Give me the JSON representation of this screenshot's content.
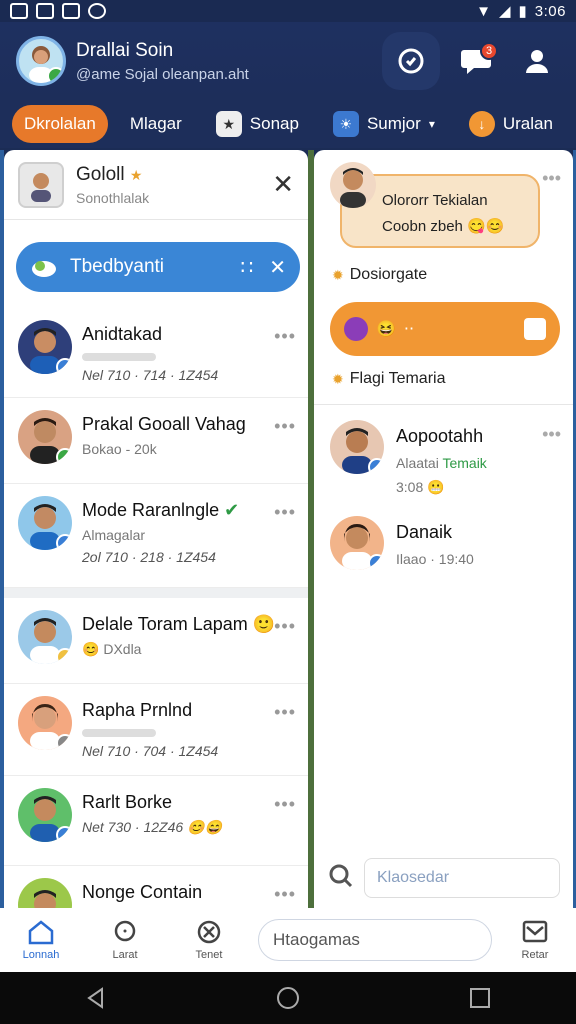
{
  "status_bar": {
    "time": "3:06"
  },
  "header": {
    "name": "Drallai Soin",
    "subtitle": "@ame Sojal oleanpan.aht"
  },
  "tabs": [
    {
      "label": "Dkrolalan",
      "active": true
    },
    {
      "label": "Mlagar"
    },
    {
      "label": "Sonap"
    },
    {
      "label": "Sumjor"
    },
    {
      "label": "Uralan"
    }
  ],
  "left_panel": {
    "title": "Gololl",
    "subtitle": "Sonothlalak",
    "search_chip": {
      "label": "Tbedbyanti"
    },
    "contacts": [
      {
        "name": "Anidtakad",
        "meta": "Nel 710 · 714 · 1Z454",
        "has_bar": true
      },
      {
        "name": "Prakal Gooall Vahag",
        "meta": "Bokao - 20k"
      },
      {
        "name": "Mode Raranlngle",
        "sub": "Almagalar",
        "meta": "2ol 710 · 218 · 1Z454"
      },
      {
        "name": "Delale Toram Lapam",
        "meta": "DXdla"
      },
      {
        "name": "Rapha Prnlnd",
        "meta": "Nel 710 · 704 · 1Z454",
        "has_bar": true
      },
      {
        "name": "Rarlt Borke",
        "meta": "Net 730 · 12Z46"
      },
      {
        "name": "Nonge Contain"
      }
    ]
  },
  "right_panel": {
    "bubble_top": {
      "line1": "Olororr Tekialan",
      "line2": "Coobn zbeh"
    },
    "label1": "Dosiorgate",
    "label2": "Flagi Temaria",
    "contacts": [
      {
        "name": "Aopootahh",
        "sub_a": "Alaatai",
        "sub_b": "Temaik",
        "time": "3:08"
      },
      {
        "name": "Danaik",
        "sub": "Ilaao · 19:40"
      }
    ],
    "input_placeholder": "Klaosedar"
  },
  "bottom_nav": {
    "home_label": "Lonnah",
    "search_label": "Larat",
    "x_label": "Tenet",
    "search_placeholder": "Htaogamas",
    "inbox_label": "Retar"
  },
  "colors": {
    "accent": "#e7792a",
    "brand": "#1d2e5a",
    "chip": "#3a86d6"
  },
  "icons": [
    "wifi-icon",
    "signal-icon",
    "battery-icon",
    "check-circle-icon",
    "chat-icon",
    "user-icon",
    "close-icon",
    "grid-icon",
    "home-icon",
    "search-icon",
    "cancel-icon",
    "inbox-icon",
    "back-icon",
    "home-circle-icon",
    "recents-icon"
  ]
}
